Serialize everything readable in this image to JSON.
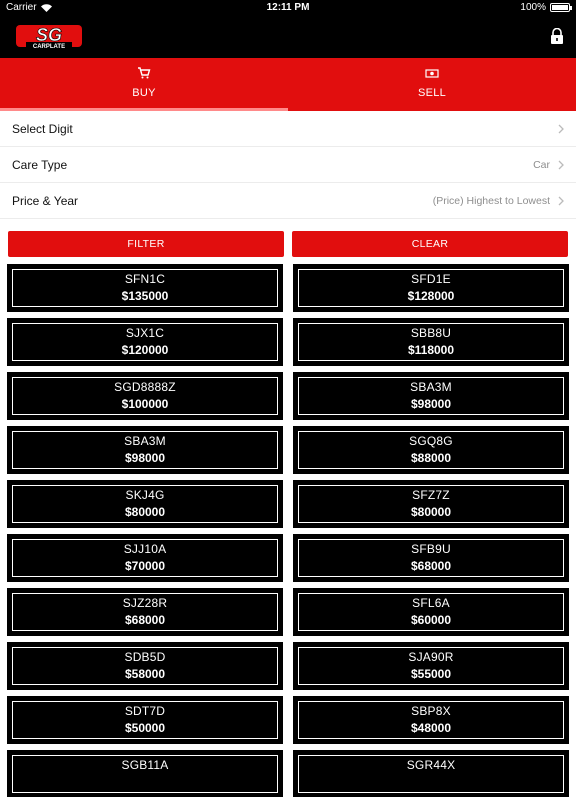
{
  "status_bar": {
    "carrier": "Carrier",
    "time": "12:11 PM",
    "battery": "100%"
  },
  "header": {
    "logo_text_top": "SG",
    "logo_text_bottom": "CARPLATE",
    "lock_icon": "lock-icon"
  },
  "tabs": [
    {
      "label": "BUY",
      "icon": "cart-icon",
      "active": true
    },
    {
      "label": "SELL",
      "icon": "cash-icon",
      "active": false
    }
  ],
  "filters": [
    {
      "label": "Select Digit",
      "value": ""
    },
    {
      "label": "Care Type",
      "value": "Car"
    },
    {
      "label": "Price & Year",
      "value": "(Price) Highest to Lowest"
    }
  ],
  "buttons": {
    "filter": "FILTER",
    "clear": "CLEAR"
  },
  "colors": {
    "brand_red": "#e10e0e",
    "plate_black": "#000000"
  },
  "plates": [
    {
      "number": "SFN1C",
      "price": "$135000"
    },
    {
      "number": "SFD1E",
      "price": "$128000"
    },
    {
      "number": "SJX1C",
      "price": "$120000"
    },
    {
      "number": "SBB8U",
      "price": "$118000"
    },
    {
      "number": "SGD8888Z",
      "price": "$100000"
    },
    {
      "number": "SBA3M",
      "price": "$98000"
    },
    {
      "number": "SBA3M",
      "price": "$98000"
    },
    {
      "number": "SGQ8G",
      "price": "$88000"
    },
    {
      "number": "SKJ4G",
      "price": "$80000"
    },
    {
      "number": "SFZ7Z",
      "price": "$80000"
    },
    {
      "number": "SJJ10A",
      "price": "$70000"
    },
    {
      "number": "SFB9U",
      "price": "$68000"
    },
    {
      "number": "SJZ28R",
      "price": "$68000"
    },
    {
      "number": "SFL6A",
      "price": "$60000"
    },
    {
      "number": "SDB5D",
      "price": "$58000"
    },
    {
      "number": "SJA90R",
      "price": "$55000"
    },
    {
      "number": "SDT7D",
      "price": "$50000"
    },
    {
      "number": "SBP8X",
      "price": "$48000"
    },
    {
      "number": "SGB11A",
      "price": ""
    },
    {
      "number": "SGR44X",
      "price": ""
    }
  ]
}
